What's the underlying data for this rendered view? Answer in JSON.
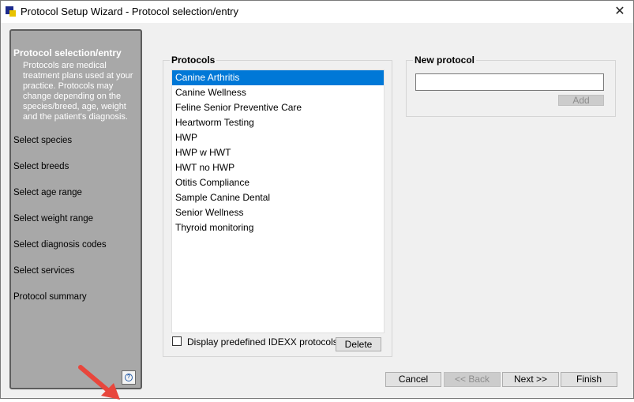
{
  "window": {
    "title": "Protocol Setup Wizard - Protocol selection/entry",
    "close_glyph": "✕"
  },
  "sidebar": {
    "heading": "Protocol selection/entry",
    "description": "Protocols are medical treatment plans used at your practice. Protocols may change depending on the species/breed, age, weight and the patient's diagnosis.",
    "steps": [
      {
        "label": "Select species"
      },
      {
        "label": "Select breeds"
      },
      {
        "label": "Select age range"
      },
      {
        "label": "Select weight range"
      },
      {
        "label": "Select diagnosis codes"
      },
      {
        "label": "Select services"
      },
      {
        "label": "Protocol summary"
      }
    ],
    "help_icon_glyph": "?"
  },
  "protocols": {
    "title": "Protocols",
    "items": [
      {
        "label": "Canine Arthritis",
        "selected": true
      },
      {
        "label": "Canine Wellness"
      },
      {
        "label": "Feline Senior Preventive Care"
      },
      {
        "label": "Heartworm Testing"
      },
      {
        "label": "HWP"
      },
      {
        "label": "HWP w HWT"
      },
      {
        "label": "HWT no HWP"
      },
      {
        "label": "Otitis Compliance"
      },
      {
        "label": "Sample Canine Dental"
      },
      {
        "label": "Senior Wellness"
      },
      {
        "label": "Thyroid monitoring"
      }
    ],
    "checkbox_label": "Display predefined IDEXX protocols",
    "checkbox_checked": false,
    "delete_label": "Delete"
  },
  "new_protocol": {
    "title": "New protocol",
    "value": "",
    "add_label": "Add"
  },
  "footer": {
    "cancel": "Cancel",
    "back": "<<  Back",
    "next": "Next   >>",
    "finish": "Finish"
  },
  "colors": {
    "selection": "#0078d7",
    "sidebar": "#a8a8a8",
    "annotation_arrow": "#e8463c"
  }
}
